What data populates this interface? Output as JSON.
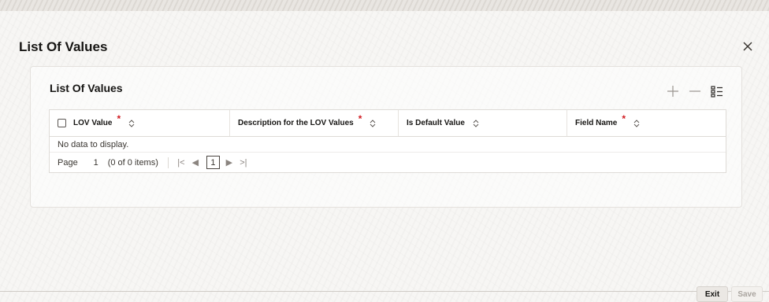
{
  "dialog": {
    "title": "List Of Values",
    "close_icon": "close-icon"
  },
  "panel": {
    "title": "List Of Values",
    "toolbar": {
      "add_icon": "plus-icon",
      "remove_icon": "minus-icon",
      "view_icon": "list-view-icon"
    }
  },
  "grid": {
    "columns": [
      {
        "label": "LOV Value",
        "required": "*"
      },
      {
        "label": "Description for the LOV Values",
        "required": "*"
      },
      {
        "label": "Is Default Value",
        "required": ""
      },
      {
        "label": "Field Name",
        "required": "*"
      }
    ],
    "empty_message": "No data to display.",
    "pager": {
      "page_label": "Page",
      "page_value": "1",
      "item_count": "(0 of 0 items)",
      "current_page": "1"
    }
  },
  "footer": {
    "exit_label": "Exit",
    "save_label": "Save"
  },
  "colors": {
    "required": "#d0191f",
    "text": "#161513"
  }
}
